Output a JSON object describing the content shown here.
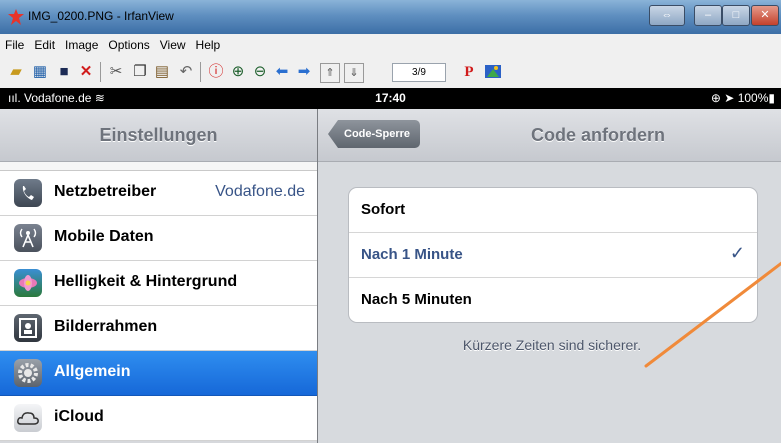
{
  "window": {
    "title": "IMG_0200.PNG - IrfanView"
  },
  "menu": [
    "File",
    "Edit",
    "Image",
    "Options",
    "View",
    "Help"
  ],
  "toolbar": {
    "page_counter": "3/9",
    "p_button": "P",
    "icons": [
      "open-icon",
      "thumbnails-icon",
      "save-icon",
      "delete-icon",
      "cut-icon",
      "copy-icon",
      "paste-icon",
      "undo-icon",
      "info-icon",
      "zoom-in-icon",
      "zoom-out-icon",
      "previous-icon",
      "next-icon",
      "first-page-icon",
      "last-page-icon",
      "paint-icon"
    ]
  },
  "statusbar": {
    "carrier": "Vodafone.de",
    "time": "17:40",
    "battery": "100%"
  },
  "sidebar": {
    "title": "Einstellungen",
    "items": [
      {
        "label": "Netzbetreiber",
        "value": "Vodafone.de"
      },
      {
        "label": "Mobile Daten"
      },
      {
        "label": "Helligkeit & Hintergrund"
      },
      {
        "label": "Bilderrahmen"
      },
      {
        "label": "Allgemein"
      },
      {
        "label": "iCloud"
      }
    ],
    "selected_index": 4
  },
  "detail": {
    "back_label": "Code-Sperre",
    "title": "Code anfordern",
    "options": [
      {
        "label": "Sofort"
      },
      {
        "label": "Nach 1 Minute",
        "checked": true
      },
      {
        "label": "Nach 5 Minuten"
      }
    ],
    "check_glyph": "✓",
    "footer": "Kürzere Zeiten sind sicherer."
  },
  "colors": {
    "selected_row": "#1f76e2",
    "checked_text": "#385487",
    "annotation_line": "#f08a3a"
  }
}
